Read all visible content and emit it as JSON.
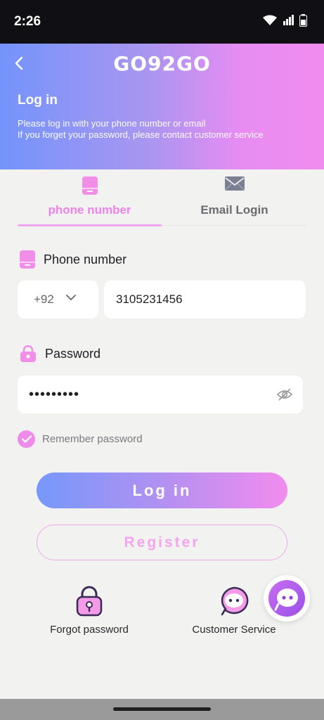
{
  "status_bar": {
    "time": "2:26",
    "icons": [
      "wifi-icon",
      "signal-icon",
      "battery-icon"
    ]
  },
  "header": {
    "brand": "GO92GO",
    "title": "Log in",
    "desc_line1": "Please log in with your phone number or email",
    "desc_line2": "If you forget your password, please contact customer service"
  },
  "tabs": {
    "phone": {
      "label": "phone number",
      "icon": "phone-icon",
      "active": true
    },
    "email": {
      "label": "Email Login",
      "icon": "envelope-icon",
      "active": false
    }
  },
  "phone_field": {
    "label": "Phone number",
    "country_code": "+92",
    "value": "3105231456"
  },
  "password_field": {
    "label": "Password",
    "value": "•••••••••"
  },
  "remember": {
    "label": "Remember password",
    "checked": true
  },
  "buttons": {
    "login": "Log in",
    "register": "Register"
  },
  "bottom_links": {
    "forgot": "Forgot password",
    "service": "Customer Service"
  },
  "colors": {
    "accent_pink": "#ef82ea",
    "accent_blue": "#7698fa",
    "background": "#f2f2f1"
  }
}
